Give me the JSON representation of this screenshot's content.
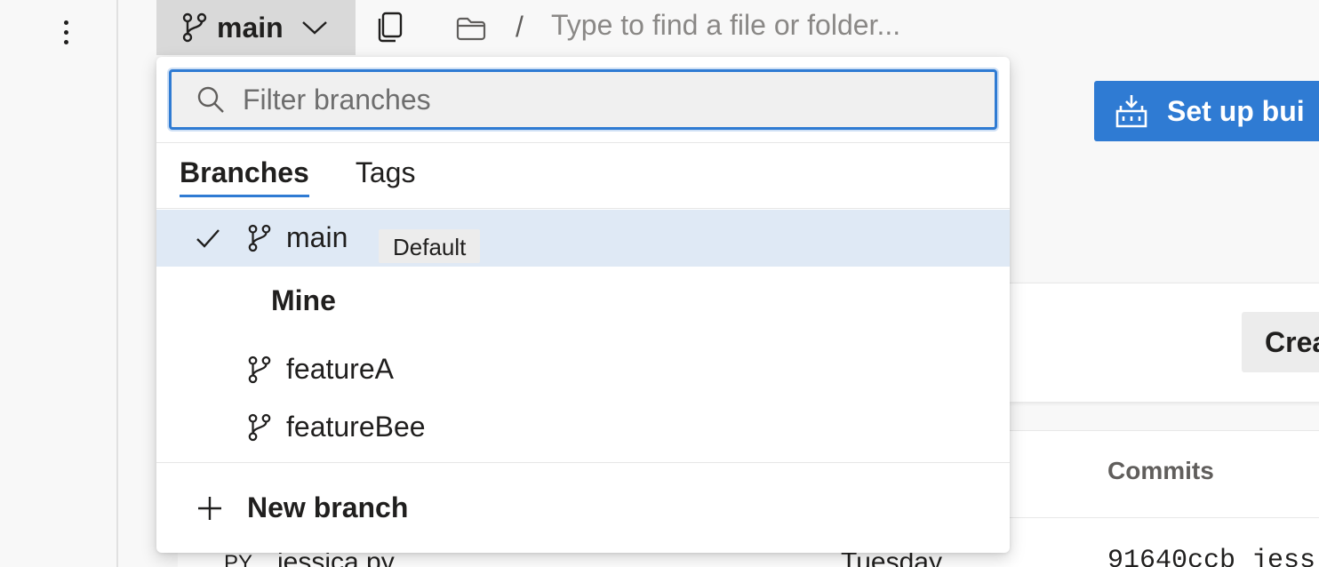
{
  "toolbar": {
    "branch_label": "main",
    "path_separator": "/",
    "path_placeholder": "Type to find a file or folder..."
  },
  "background": {
    "setup_build_label": "Set up bui",
    "create_label": "Crea",
    "commits_header": "Commits",
    "file_row": {
      "type": "PY",
      "name": "jessica.py",
      "date": "Tuesday",
      "commit": "91640ccb jess"
    }
  },
  "dropdown": {
    "filter_placeholder": "Filter branches",
    "tabs": [
      {
        "label": "Branches",
        "active": true
      },
      {
        "label": "Tags",
        "active": false
      }
    ],
    "current_branch": {
      "name": "main",
      "badge": "Default"
    },
    "groups": [
      {
        "title": "Mine",
        "branches": [
          {
            "name": "featureA"
          },
          {
            "name": "featureBee"
          }
        ]
      }
    ],
    "new_branch_label": "New branch"
  },
  "colors": {
    "accent": "#2f7bd3",
    "selected_row": "#dfe9f5",
    "toolbar_button": "#d9d9d9"
  }
}
